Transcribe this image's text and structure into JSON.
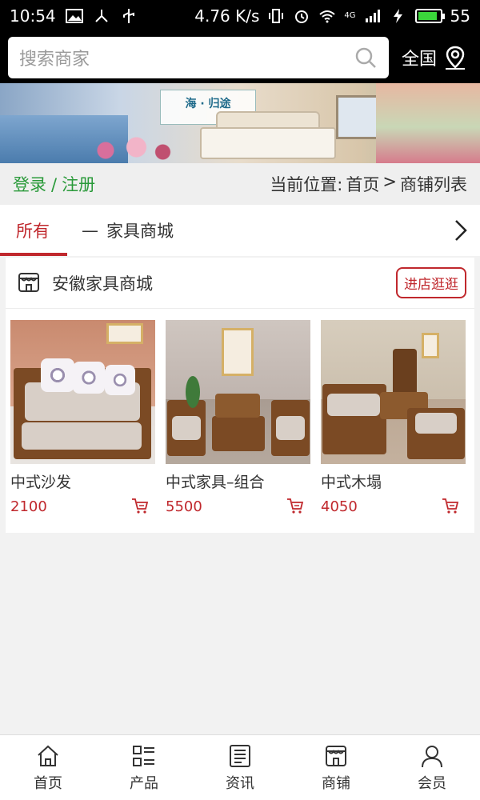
{
  "status_bar": {
    "time": "10:54",
    "network_speed": "4.76 K/s",
    "signal_type": "4G",
    "battery_level": "55",
    "battery_fill_percent": 90,
    "colors": {
      "battery": "#3bd63b"
    }
  },
  "search": {
    "placeholder": "搜索商家",
    "icon": "search-icon"
  },
  "region": {
    "label": "全国",
    "icon": "location-pin-icon"
  },
  "banner": {
    "title": "海 · 归途"
  },
  "auth": {
    "login": "登录",
    "separator": "/",
    "register": "注册"
  },
  "breadcrumb": {
    "prefix": "当前位置:",
    "home": "首页",
    "arrow": ">",
    "current": "商铺列表"
  },
  "tabs": {
    "items": [
      {
        "label": "所有",
        "active": true
      },
      {
        "label": "家具商城",
        "prefix": "—"
      }
    ],
    "more_icon": "chevron-right-icon"
  },
  "store": {
    "icon": "shop-icon",
    "name": "安徽家具商城",
    "visit_button": "进店逛逛"
  },
  "products": [
    {
      "name": "中式沙发",
      "price": "2100",
      "icon": "cart-icon"
    },
    {
      "name": "中式家具–组合",
      "price": "5500",
      "icon": "cart-icon"
    },
    {
      "name": "中式木塌",
      "price": "4050",
      "icon": "cart-icon"
    }
  ],
  "bottom_nav": {
    "items": [
      {
        "label": "首页",
        "icon": "home-icon"
      },
      {
        "label": "产品",
        "icon": "grid-list-icon"
      },
      {
        "label": "资讯",
        "icon": "news-icon"
      },
      {
        "label": "商铺",
        "icon": "shop-icon"
      },
      {
        "label": "会员",
        "icon": "user-icon"
      }
    ]
  },
  "colors": {
    "accent_red": "#c0282d",
    "login_green": "#2a9a3a"
  }
}
